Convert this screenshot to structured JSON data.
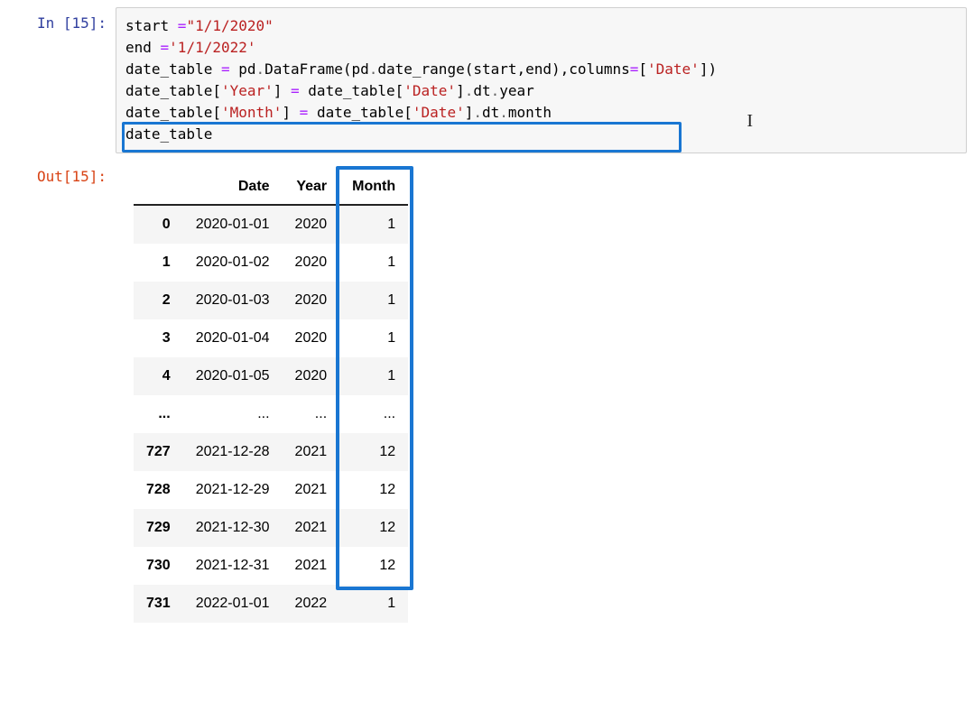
{
  "input": {
    "prompt": "In [15]:",
    "code_lines": {
      "l1a": "start ",
      "l1b": "=",
      "l1c": "\"1/1/2020\"",
      "l2a": "end ",
      "l2b": "=",
      "l2c": "'1/1/2022'",
      "l3a": "date_table ",
      "l3b": "= ",
      "l3c": "pd",
      "l3d": ".",
      "l3e": "DataFrame(pd",
      "l3f": ".",
      "l3g": "date_range(start,end),columns",
      "l3h": "=",
      "l3i": "[",
      "l3j": "'Date'",
      "l3k": "])",
      "l4a": "date_table[",
      "l4b": "'Year'",
      "l4c": "] ",
      "l4d": "= ",
      "l4e": "date_table[",
      "l4f": "'Date'",
      "l4g": "]",
      "l4h": ".",
      "l4i": "dt",
      "l4j": ".",
      "l4k": "year",
      "l5a": "date_table[",
      "l5b": "'Month'",
      "l5c": "] ",
      "l5d": "= ",
      "l5e": "date_table[",
      "l5f": "'Date'",
      "l5g": "]",
      "l5h": ".",
      "l5i": "dt",
      "l5j": ".",
      "l5k": "month",
      "l6": "date_table"
    }
  },
  "output": {
    "prompt": "Out[15]:",
    "columns": {
      "date": "Date",
      "year": "Year",
      "month": "Month"
    },
    "ellipsis": "...",
    "rows": [
      {
        "idx": "0",
        "date": "2020-01-01",
        "year": "2020",
        "month": "1"
      },
      {
        "idx": "1",
        "date": "2020-01-02",
        "year": "2020",
        "month": "1"
      },
      {
        "idx": "2",
        "date": "2020-01-03",
        "year": "2020",
        "month": "1"
      },
      {
        "idx": "3",
        "date": "2020-01-04",
        "year": "2020",
        "month": "1"
      },
      {
        "idx": "4",
        "date": "2020-01-05",
        "year": "2020",
        "month": "1"
      },
      {
        "idx": "727",
        "date": "2021-12-28",
        "year": "2021",
        "month": "12"
      },
      {
        "idx": "728",
        "date": "2021-12-29",
        "year": "2021",
        "month": "12"
      },
      {
        "idx": "729",
        "date": "2021-12-30",
        "year": "2021",
        "month": "12"
      },
      {
        "idx": "730",
        "date": "2021-12-31",
        "year": "2021",
        "month": "12"
      },
      {
        "idx": "731",
        "date": "2022-01-01",
        "year": "2022",
        "month": "1"
      }
    ]
  },
  "colors": {
    "highlight": "#1976D2"
  }
}
